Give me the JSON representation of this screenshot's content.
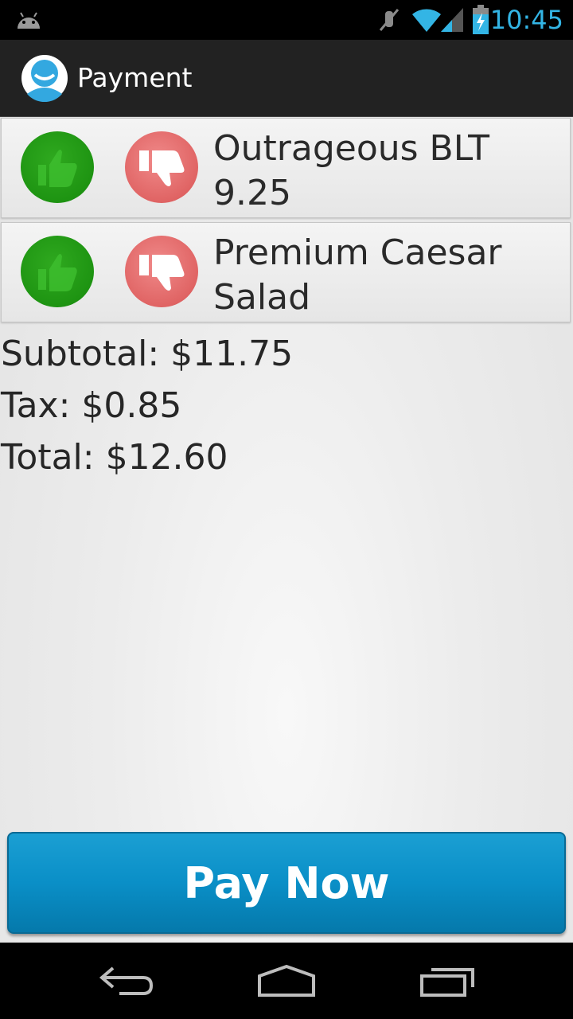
{
  "status_bar": {
    "time": "10:45",
    "icons": [
      "android-icon",
      "mute-icon",
      "wifi-icon",
      "signal-icon",
      "battery-charging-icon"
    ]
  },
  "action_bar": {
    "title": "Payment",
    "logo_icon": "app-logo-icon"
  },
  "items": [
    {
      "name": "Outrageous BLT",
      "price": "9.25"
    },
    {
      "name": "Premium Caesar",
      "name_line2": "Salad"
    }
  ],
  "totals": {
    "subtotal": "Subtotal: $11.75",
    "tax": "Tax: $0.85",
    "total": "Total: $12.60"
  },
  "pay_button": {
    "label": "Pay Now"
  },
  "nav_bar": {
    "icons": [
      "back-icon",
      "home-icon",
      "recent-apps-icon"
    ]
  },
  "colors": {
    "accent": "#33b5e5",
    "pay_button": "#0a8fc7",
    "thumb_up": "#1e9412",
    "thumb_down": "#e06464"
  }
}
